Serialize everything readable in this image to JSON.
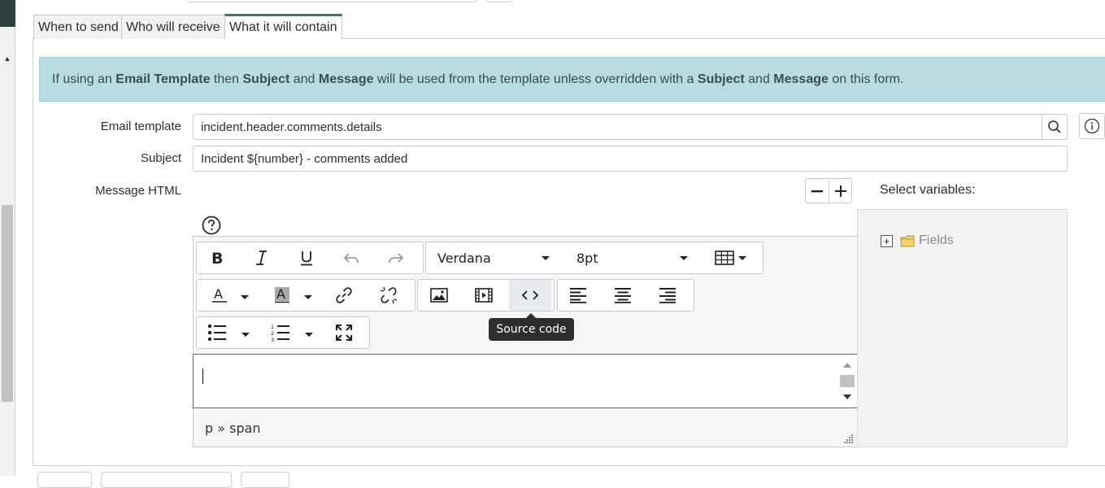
{
  "tabs": [
    {
      "label": "When to send",
      "active": false
    },
    {
      "label": "Who will receive",
      "active": false
    },
    {
      "label": "What it will contain",
      "active": true
    }
  ],
  "banner": {
    "t1": "If using an ",
    "b1": "Email Template",
    "t2": " then ",
    "b2": "Subject",
    "t3": " and ",
    "b3": "Message",
    "t4": " will be used from the template unless overridden with a ",
    "b4": "Subject",
    "t5": " and ",
    "b5": "Message",
    "t6": " on this form."
  },
  "form": {
    "email_template_label": "Email template",
    "email_template_value": "incident.header.comments.details",
    "subject_label": "Subject",
    "subject_value": "Incident ${number} - comments added",
    "message_label": "Message HTML"
  },
  "editor": {
    "font_family": "Verdana",
    "font_size": "8pt",
    "status_path": "p » span",
    "tooltip": "Source code"
  },
  "variables": {
    "title": "Select variables:",
    "tree": [
      {
        "label": "Fields",
        "icon": "folder-icon"
      }
    ]
  },
  "colors": {
    "active_tab": "#2e7d6e",
    "banner_bg": "#b7dde3",
    "editor_focus": "#2b78c5"
  }
}
